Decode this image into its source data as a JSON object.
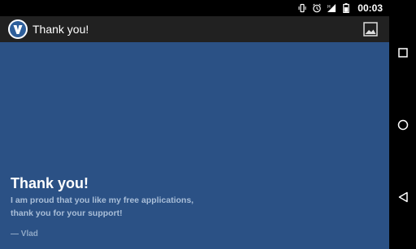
{
  "status_bar": {
    "time": "00:03",
    "icons": [
      "vibrate-icon",
      "alarm-icon",
      "signal-icon",
      "battery-icon"
    ]
  },
  "action_bar": {
    "title": "Thank you!",
    "logo_icon": "app-logo-icon",
    "action_icon": "image-icon"
  },
  "content": {
    "heading": "Thank you!",
    "message": "I am proud that you like my free applications, thank you for your support!",
    "signature": "— Vlad"
  },
  "navigation_bar": {
    "buttons": [
      "recent-apps-icon",
      "home-icon",
      "back-icon"
    ]
  },
  "colors": {
    "background": "#2b5185",
    "action_bar": "#212121",
    "status_bar": "#000000"
  }
}
